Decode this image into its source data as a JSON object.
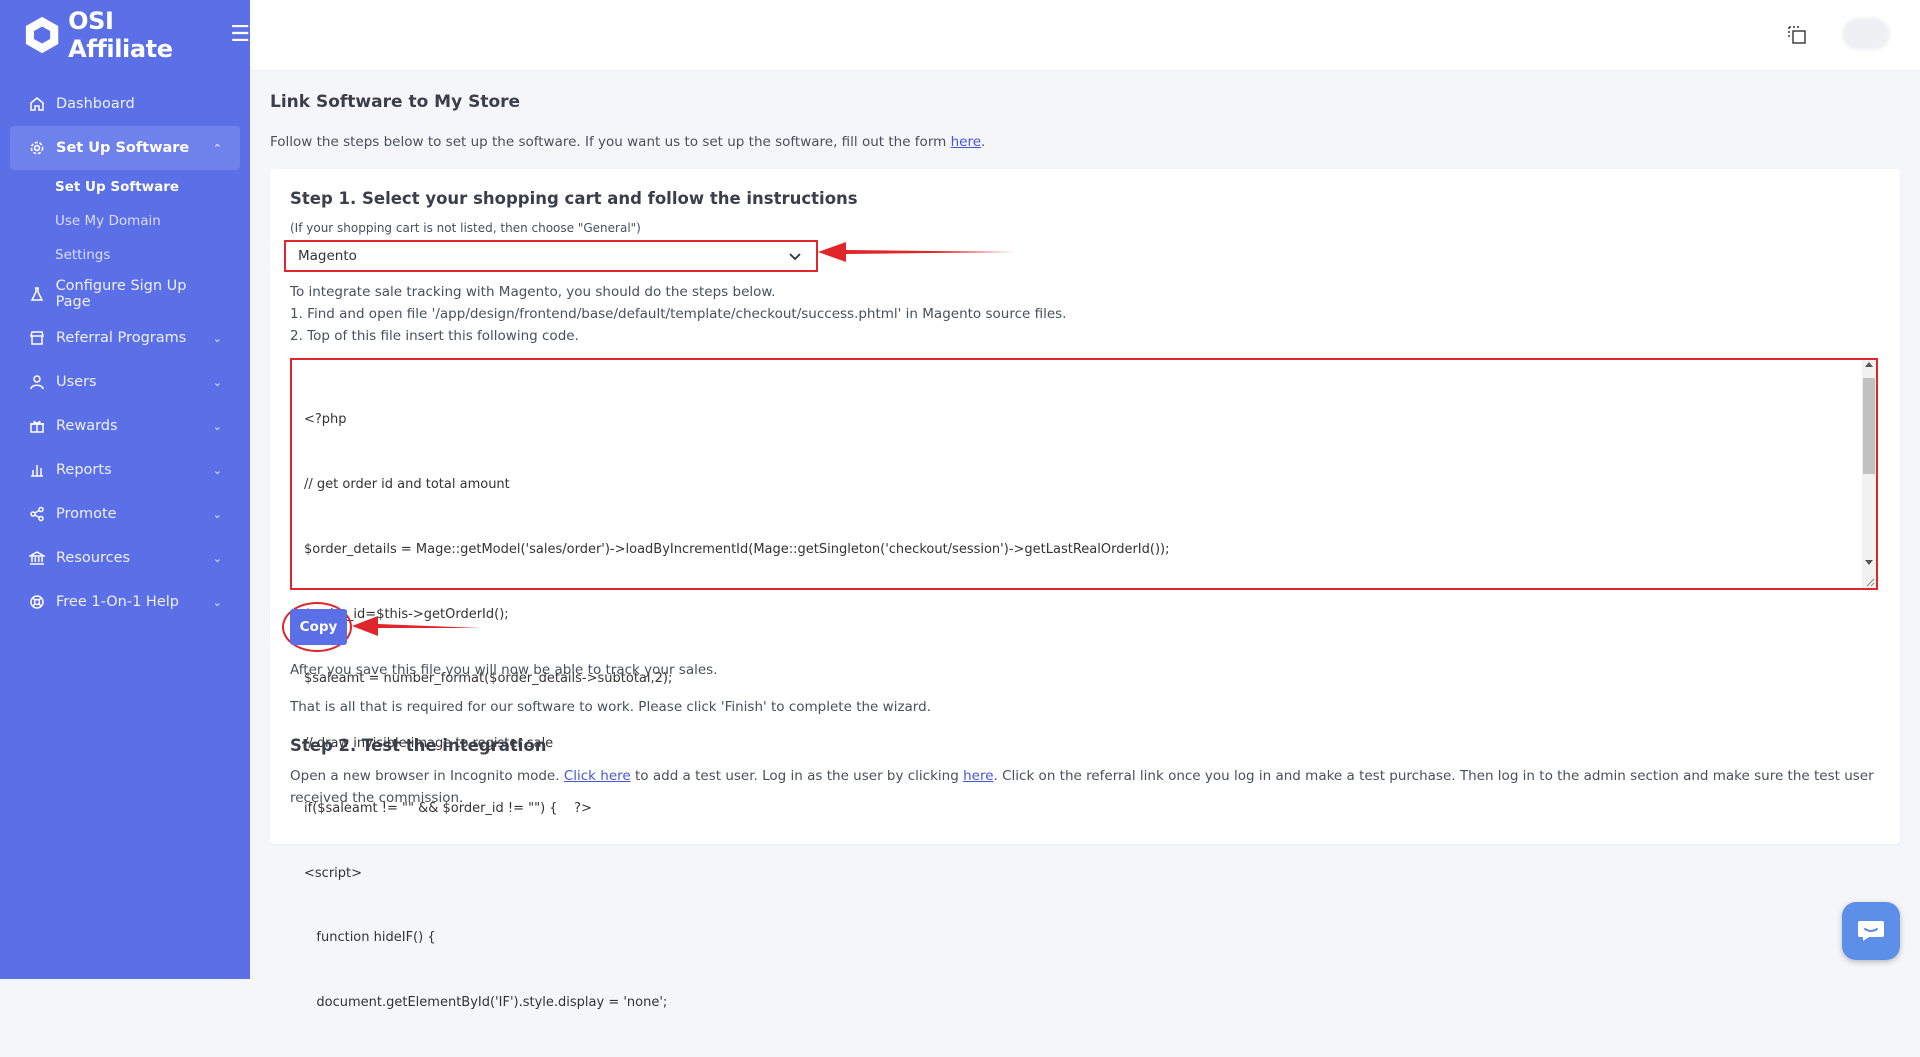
{
  "brand": {
    "name": "OSI Affiliate"
  },
  "sidebar": {
    "items": [
      {
        "label": "Dashboard",
        "icon": "home-icon"
      },
      {
        "label": "Set Up Software",
        "icon": "gear-icon",
        "expanded": true,
        "children": [
          {
            "label": "Set Up Software",
            "current": true
          },
          {
            "label": "Use My Domain"
          },
          {
            "label": "Settings"
          }
        ]
      },
      {
        "label": "Configure Sign Up Page",
        "icon": "flask-icon"
      },
      {
        "label": "Referral Programs",
        "icon": "store-icon"
      },
      {
        "label": "Users",
        "icon": "user-icon"
      },
      {
        "label": "Rewards",
        "icon": "gift-icon"
      },
      {
        "label": "Reports",
        "icon": "bar-chart-icon"
      },
      {
        "label": "Promote",
        "icon": "share-icon"
      },
      {
        "label": "Resources",
        "icon": "bank-icon"
      },
      {
        "label": "Free 1-On-1 Help",
        "icon": "lifebuoy-icon"
      }
    ]
  },
  "page": {
    "title": "Link Software to My Store",
    "intro_text": "Follow the steps below to set up the software. If you want us to set up the software, fill out the form ",
    "intro_link": "here",
    "intro_end": "."
  },
  "step1": {
    "title": "Step 1. Select your shopping cart and follow the instructions",
    "hint": "(If your shopping cart is not listed, then choose \"General\")",
    "selected_cart": "Magento",
    "instructions": [
      "To integrate sale tracking with Magento, you should do the steps below.",
      "1. Find and open file '/app/design/frontend/base/default/template/checkout/success.phtml' in Magento source files.",
      "2. Top of this file insert this following code."
    ],
    "code": [
      "<?php",
      "// get order id and total amount",
      "$order_details = Mage::getModel('sales/order')->loadByIncrementId(Mage::getSingleton('checkout/session')->getLastRealOrderId());",
      "$order_id=$this->getOrderId();",
      "$saleamt = number_format($order_details->subtotal,2);",
      "// draw invisible image to register sale",
      "if($saleamt != \"\" && $order_id != \"\") {    ?>",
      "<script>",
      "   function hideIF() {",
      "   document.getElementById('IF').style.display = 'none';"
    ],
    "copy_label": "Copy",
    "after_save": "After you save this file you will now be able to track your sales.",
    "all_required": "That is all that is required for our software to work. Please click 'Finish' to complete the wizard."
  },
  "step2": {
    "title": "Step 2. Test the integration",
    "text_1": "Open a new browser in Incognito mode. ",
    "link_1": "Click here",
    "text_2": " to add a test user. Log in as the user by clicking ",
    "link_2": "here",
    "text_3": ". Click on the referral link once you log in and make a test purchase. Then log in to the admin section and make sure the test user received the commission."
  },
  "colors": {
    "sidebar": "#5b6fe6",
    "accent": "#5b6fe6",
    "annotation_red": "#e0262b",
    "link": "#4655d9"
  }
}
